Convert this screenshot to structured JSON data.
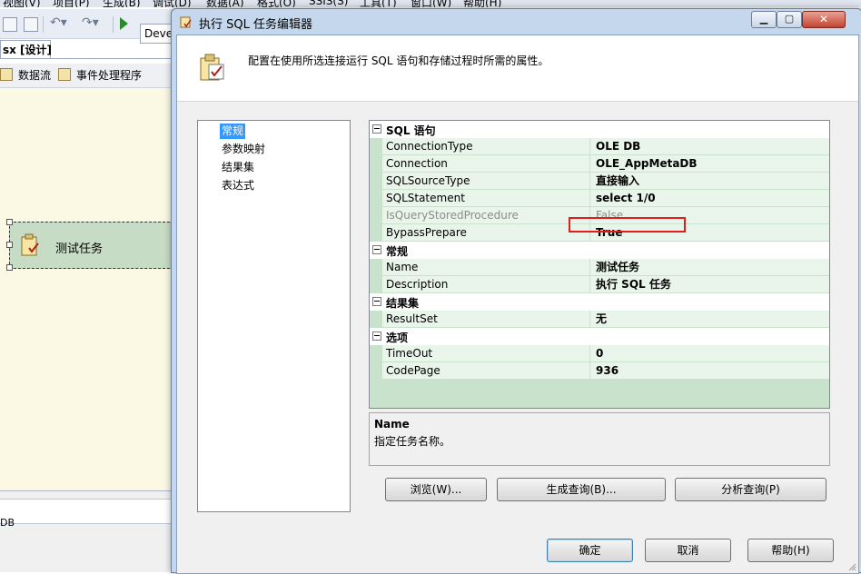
{
  "ide": {
    "menu": [
      "视图(V)",
      "项目(P)",
      "生成(B)",
      "调试(D)",
      "数据(A)",
      "格式(O)",
      "SSIS(S)",
      "工具(T)",
      "窗口(W)",
      "帮助(H)"
    ],
    "toolbar_combo": "Devel",
    "doc_tab": "sx [设计]",
    "design_tabs": [
      "数据流",
      "事件处理程序"
    ],
    "task_label": "测试任务",
    "bottom_text": "DB"
  },
  "dialog": {
    "title": "执行 SQL 任务编辑器",
    "header_text": "配置在使用所选连接运行 SQL 语句和存储过程时所需的属性。",
    "nav": [
      "常规",
      "参数映射",
      "结果集",
      "表达式"
    ],
    "nav_selected": "常规",
    "categories": [
      {
        "title": "SQL 语句",
        "props": [
          {
            "name": "ConnectionType",
            "value": "OLE DB",
            "disabled": false
          },
          {
            "name": "Connection",
            "value": "OLE_AppMetaDB",
            "disabled": false
          },
          {
            "name": "SQLSourceType",
            "value": "直接输入",
            "disabled": false
          },
          {
            "name": "SQLStatement",
            "value": "select 1/0",
            "disabled": false,
            "highlighted": true
          },
          {
            "name": "IsQueryStoredProcedure",
            "value": "False",
            "disabled": true
          },
          {
            "name": "BypassPrepare",
            "value": "True",
            "disabled": false
          }
        ]
      },
      {
        "title": "常规",
        "props": [
          {
            "name": "Name",
            "value": "测试任务",
            "disabled": false
          },
          {
            "name": "Description",
            "value": "执行 SQL 任务",
            "disabled": false
          }
        ]
      },
      {
        "title": "结果集",
        "props": [
          {
            "name": "ResultSet",
            "value": "无",
            "disabled": false
          }
        ]
      },
      {
        "title": "选项",
        "props": [
          {
            "name": "TimeOut",
            "value": "0",
            "disabled": false
          },
          {
            "name": "CodePage",
            "value": "936",
            "disabled": false
          }
        ]
      }
    ],
    "description": {
      "title": "Name",
      "text": "指定任务名称。"
    },
    "action_buttons": {
      "browse": "浏览(W)...",
      "build_query": "生成查询(B)...",
      "parse_query": "分析查询(P)"
    },
    "footer_buttons": {
      "ok": "确定",
      "cancel": "取消",
      "help": "帮助(H)"
    }
  },
  "colors": {
    "grid_bg": "#c8e2cc",
    "highlight_box": "#e31b1b",
    "nav_selected": "#3399ff"
  }
}
